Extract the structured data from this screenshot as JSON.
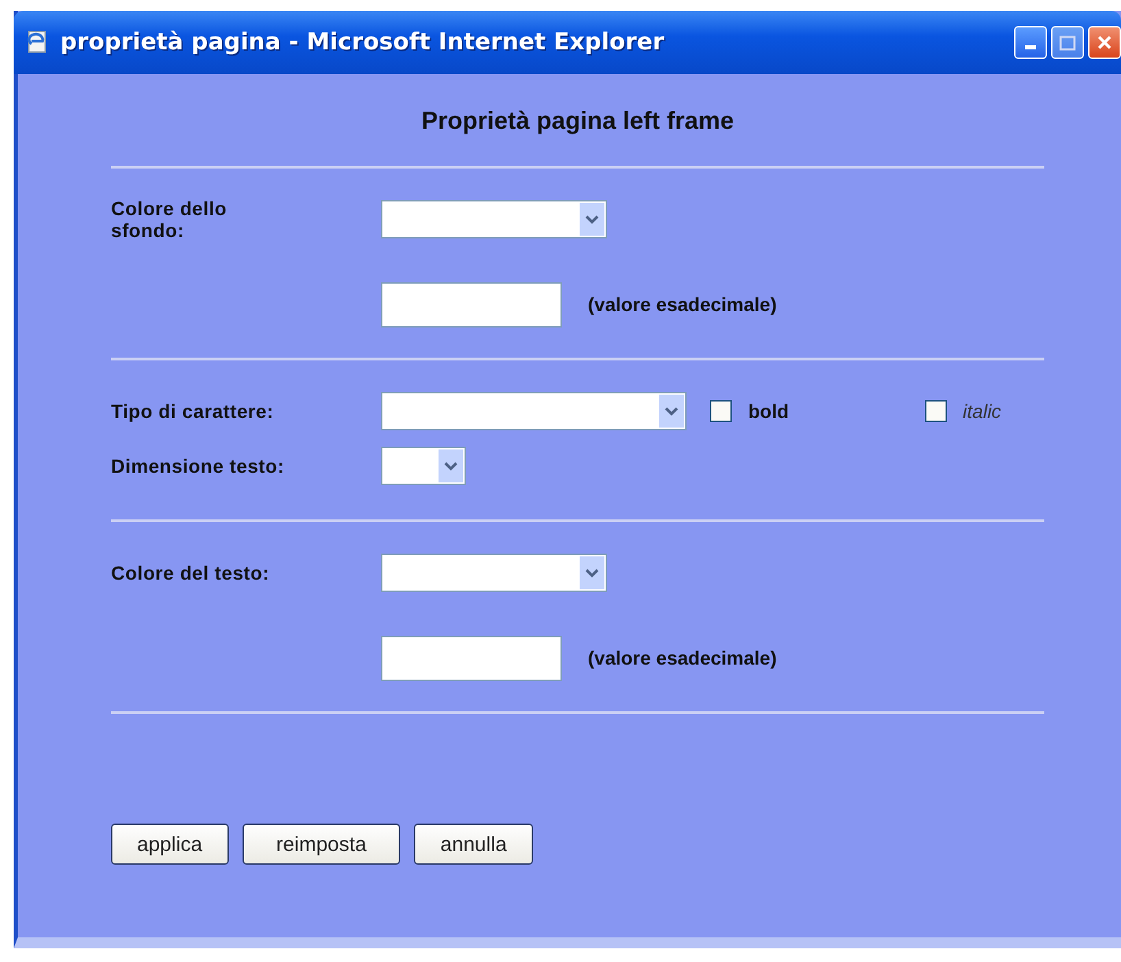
{
  "window": {
    "title": "proprietà pagina - Microsoft Internet Explorer"
  },
  "heading": "Proprietà pagina left frame",
  "sections": [
    {
      "rows": [
        {
          "kind": "color",
          "label": "Colore dello sfondo:",
          "hint": "(valore esadecimale)"
        }
      ]
    },
    {
      "rows": [
        {
          "kind": "font",
          "label": "Tipo di carattere:",
          "checkboxes": [
            {
              "kind": "bold",
              "label": "bold",
              "checked": false
            },
            {
              "kind": "italic",
              "label": "italic",
              "checked": false
            }
          ]
        },
        {
          "kind": "size",
          "label": "Dimensione testo:"
        }
      ]
    },
    {
      "rows": [
        {
          "kind": "color",
          "label": "Colore del testo:",
          "hint": "(valore esadecimale)"
        }
      ]
    }
  ],
  "buttons": [
    "applica",
    "reimposta",
    "annulla"
  ]
}
